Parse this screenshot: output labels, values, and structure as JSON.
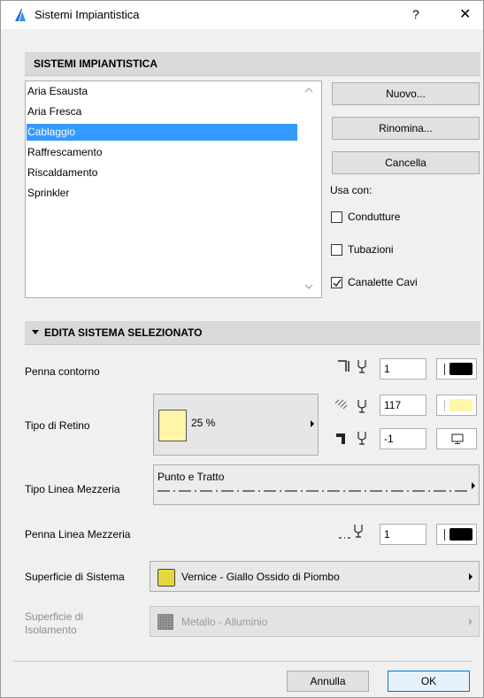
{
  "window": {
    "title": "Sistemi Impiantistica",
    "help_label": "?",
    "close_label": "✕"
  },
  "systems": {
    "header": "SISTEMI IMPIANTISTICA",
    "items": [
      "Aria Esausta",
      "Aria Fresca",
      "Cablaggio",
      "Raffrescamento",
      "Riscaldamento",
      "Sprinkler"
    ],
    "selected": "Cablaggio",
    "buttons": {
      "new": "Nuovo...",
      "rename": "Rinomina...",
      "delete": "Cancella"
    },
    "use_with_label": "Usa con:",
    "use_with": [
      {
        "label": "Condutture",
        "checked": false
      },
      {
        "label": "Tubazioni",
        "checked": false
      },
      {
        "label": "Canalette Cavi",
        "checked": true
      }
    ]
  },
  "edit": {
    "header": "EDITA SISTEMA SELEZIONATO",
    "contour_pen_label": "Penna contorno",
    "contour_pen_value": "1",
    "fill_label": "Tipo di Retino",
    "fill_percent": "25 %",
    "fill_fg_pen": "117",
    "fill_bg_pen": "-1",
    "centerline_type_label": "Tipo Linea Mezzeria",
    "centerline_type_value": "Punto e Tratto",
    "centerline_pen_label": "Penna Linea Mezzeria",
    "centerline_pen_value": "1",
    "system_surface_label": "Superficie di Sistema",
    "system_surface_value": "Vernice - Giallo Ossido di Piombo",
    "insulation_surface_label": "Superficie di Isolamento",
    "insulation_surface_value": "Metallo - Alluminio"
  },
  "footer": {
    "cancel": "Annulla",
    "ok": "OK"
  },
  "colors": {
    "selection": "#3399ff",
    "surface_yellow": "#e8d63c",
    "fill_yellow": "#fff6a8",
    "pen_black": "#000000"
  }
}
